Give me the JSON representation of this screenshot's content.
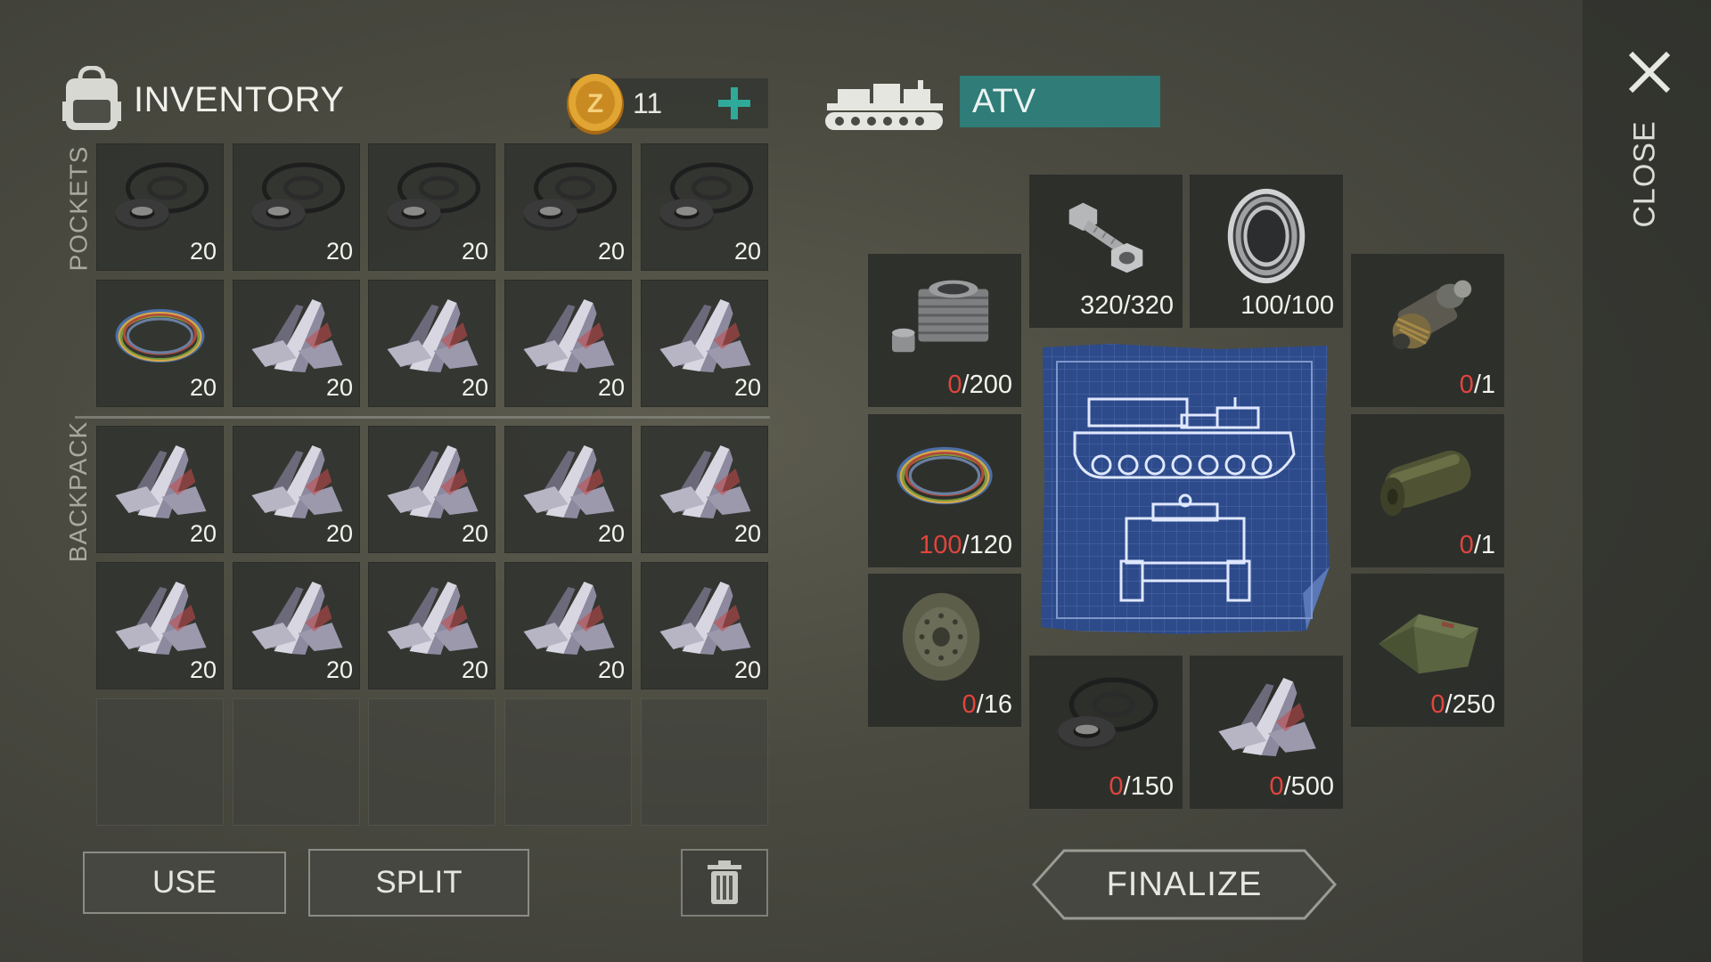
{
  "inventory": {
    "title": "INVENTORY",
    "coins": "11",
    "section_pockets": "POCKETS",
    "section_backpack": "BACKPACK",
    "pockets": [
      {
        "item": "rubber-seal",
        "qty": "20"
      },
      {
        "item": "rubber-seal",
        "qty": "20"
      },
      {
        "item": "rubber-seal",
        "qty": "20"
      },
      {
        "item": "rubber-seal",
        "qty": "20"
      },
      {
        "item": "rubber-seal",
        "qty": "20"
      },
      {
        "item": "wire-coil",
        "qty": "20"
      },
      {
        "item": "metal-scrap",
        "qty": "20"
      },
      {
        "item": "metal-scrap",
        "qty": "20"
      },
      {
        "item": "metal-scrap",
        "qty": "20"
      },
      {
        "item": "metal-scrap",
        "qty": "20"
      }
    ],
    "backpack": [
      {
        "item": "metal-scrap",
        "qty": "20"
      },
      {
        "item": "metal-scrap",
        "qty": "20"
      },
      {
        "item": "metal-scrap",
        "qty": "20"
      },
      {
        "item": "metal-scrap",
        "qty": "20"
      },
      {
        "item": "metal-scrap",
        "qty": "20"
      },
      {
        "item": "metal-scrap",
        "qty": "20"
      },
      {
        "item": "metal-scrap",
        "qty": "20"
      },
      {
        "item": "metal-scrap",
        "qty": "20"
      },
      {
        "item": "metal-scrap",
        "qty": "20"
      },
      {
        "item": "metal-scrap",
        "qty": "20"
      },
      {
        "item": "empty",
        "qty": ""
      },
      {
        "item": "empty",
        "qty": ""
      },
      {
        "item": "empty",
        "qty": ""
      },
      {
        "item": "empty",
        "qty": ""
      },
      {
        "item": "empty",
        "qty": ""
      }
    ],
    "buttons": {
      "use": "USE",
      "split": "SPLIT"
    }
  },
  "vehicle": {
    "name": "ATV",
    "parts": [
      {
        "id": "engine-cylinder",
        "item": "engine-cylinder",
        "have": "0",
        "need": "/200",
        "short": true
      },
      {
        "id": "bolts",
        "item": "bolts",
        "have": "320",
        "need": "/320",
        "short": false
      },
      {
        "id": "bearing",
        "item": "bearing",
        "have": "100",
        "need": "/100",
        "short": false
      },
      {
        "id": "gearbox",
        "item": "gearbox",
        "have": "0",
        "need": "/1",
        "short": true
      },
      {
        "id": "wire-coil",
        "item": "wire-coil",
        "have": "100",
        "need": "/120",
        "short": true
      },
      {
        "id": "fuel-tank",
        "item": "fuel-tank",
        "have": "0",
        "need": "/1",
        "short": true
      },
      {
        "id": "road-wheel",
        "item": "road-wheel",
        "have": "0",
        "need": "/16",
        "short": true
      },
      {
        "id": "tarp",
        "item": "tarp",
        "have": "0",
        "need": "/250",
        "short": true
      },
      {
        "id": "rubber-seal",
        "item": "rubber-seal",
        "have": "0",
        "need": "/150",
        "short": true
      },
      {
        "id": "metal-scrap",
        "item": "metal-scrap",
        "have": "0",
        "need": "/500",
        "short": true
      }
    ],
    "finalize_label": "FINALIZE"
  },
  "close_label": "CLOSE",
  "colors": {
    "accent_teal": "#2f7c78",
    "plus_green": "#2fa99a",
    "shortage_red": "#e0453c",
    "coin_gold": "#d89a2a"
  },
  "icons": [
    "backpack-icon",
    "coin-icon",
    "plus-icon",
    "tracked-vehicle-icon",
    "close-icon",
    "trash-icon",
    "blueprint-icon"
  ]
}
